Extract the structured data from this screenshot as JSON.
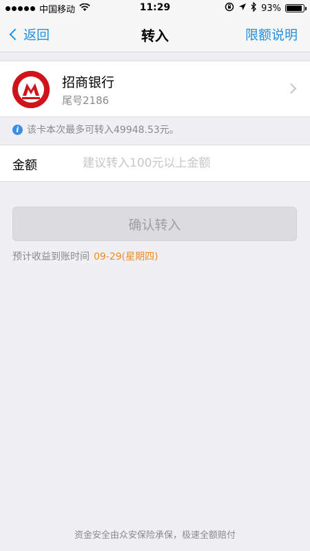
{
  "status_bar": {
    "carrier": "中国移动",
    "time": "11:29",
    "battery_text": "93%",
    "battery_level": 0.93,
    "icons": [
      "signal-dots-icon",
      "wifi-icon",
      "orientation-lock-icon",
      "location-icon",
      "bluetooth-icon",
      "battery-icon"
    ]
  },
  "nav": {
    "back_label": "返回",
    "title": "转入",
    "right_label": "限额说明"
  },
  "bank": {
    "name": "招商银行",
    "tail": "尾号2186",
    "logo_color": "#d0121b"
  },
  "notice": {
    "text": "该卡本次最多可转入49948.53元。"
  },
  "amount": {
    "label": "金额",
    "value": "",
    "placeholder": "建议转入100元以上金额"
  },
  "confirm": {
    "label": "确认转入"
  },
  "eta": {
    "label": "预计收益到账时间",
    "date": "09-29(星期四)"
  },
  "footer": {
    "text": "资金安全由众安保险承保，极速全额赔付"
  },
  "colors": {
    "accent": "#1f8fe3",
    "highlight": "#f08a24",
    "background": "#efeff4"
  }
}
